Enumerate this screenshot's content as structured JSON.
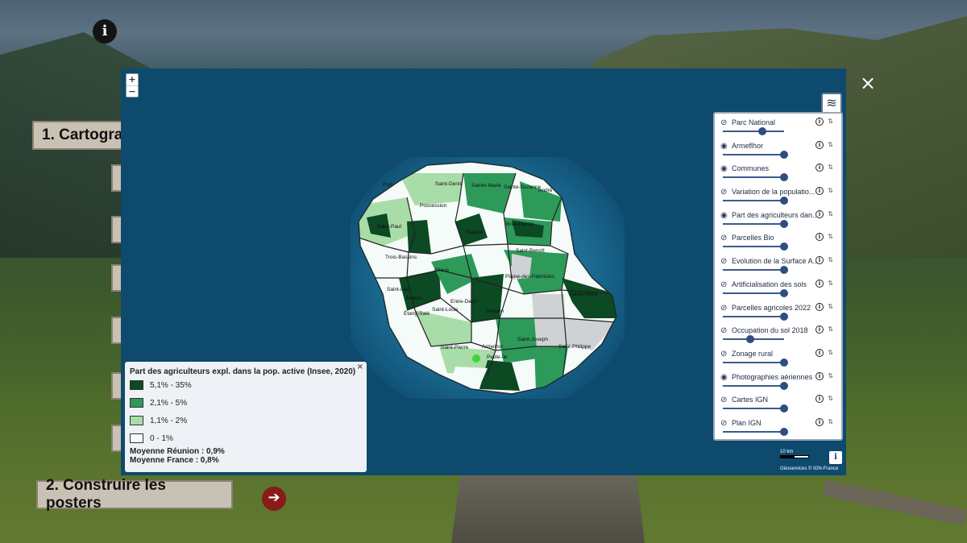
{
  "page": {
    "info_icon": "info-icon",
    "section1_label": "1. Cartogra",
    "section2_label": "2. Construire les posters",
    "next_arrow_icon": "arrow-right-icon"
  },
  "map": {
    "zoom_in": "+",
    "zoom_out": "−",
    "close_symbol": "×",
    "layers_icon": "layers-icon",
    "place_labels": [
      "Port",
      "Saint-Denis",
      "Sainte-Marie",
      "Sainte-Suzanne",
      "André",
      "Possession",
      "Saint-Paul",
      "Salazie",
      "Bras-Panon",
      "Saint-Benoît",
      "Trois-Bassins",
      "Cilaos",
      "Plaine-des-Palmistes",
      "Sainte-Rose",
      "Saint-Leu",
      "Avirons",
      "Étang-Salé",
      "Saint-Louis",
      "Entre-Deux",
      "Tampon",
      "Saint-Pierre",
      "Armelhor",
      "Petite-Île",
      "Saint-Joseph",
      "Saint-Philippe"
    ],
    "scale_label": "10 km",
    "attribution": "Géoservices © IGN-France",
    "info_symbol": "i"
  },
  "layers": [
    {
      "name": "Parc National",
      "visible": false,
      "opacity": 0.65
    },
    {
      "name": "Armeflhor",
      "visible": true,
      "opacity": 1.0
    },
    {
      "name": "Communes",
      "visible": true,
      "opacity": 1.0
    },
    {
      "name": "Variation de la populatio...",
      "visible": false,
      "opacity": 1.0
    },
    {
      "name": "Part des agriculteurs dan...",
      "visible": true,
      "opacity": 1.0
    },
    {
      "name": "Parcelles Bio",
      "visible": false,
      "opacity": 1.0
    },
    {
      "name": "Evolution de la Surface A...",
      "visible": false,
      "opacity": 1.0
    },
    {
      "name": "Artificialisation des sols",
      "visible": false,
      "opacity": 1.0
    },
    {
      "name": "Parcelles agricoles 2022",
      "visible": false,
      "opacity": 1.0
    },
    {
      "name": "Occupation du sol 2018",
      "visible": false,
      "opacity": 0.45
    },
    {
      "name": "Zonage rural",
      "visible": false,
      "opacity": 1.0
    },
    {
      "name": "Photographies aériennes",
      "visible": true,
      "opacity": 1.0
    },
    {
      "name": "Cartes IGN",
      "visible": false,
      "opacity": 1.0
    },
    {
      "name": "Plan IGN",
      "visible": false,
      "opacity": 1.0
    }
  ],
  "legend": {
    "title": "Part des agriculteurs expl. dans la pop. active (Insee, 2020)",
    "classes": [
      {
        "label": "5,1% - 35%",
        "color": "#0b4a22"
      },
      {
        "label": "2,1% - 5%",
        "color": "#2e9a5a"
      },
      {
        "label": "1,1% - 2%",
        "color": "#a8dca8"
      },
      {
        "label": "0 - 1%",
        "color": "#f4fbf8"
      }
    ],
    "stat_reunion": "Moyenne Réunion : 0,9%",
    "stat_france": "Moyenne France : 0,8%"
  }
}
